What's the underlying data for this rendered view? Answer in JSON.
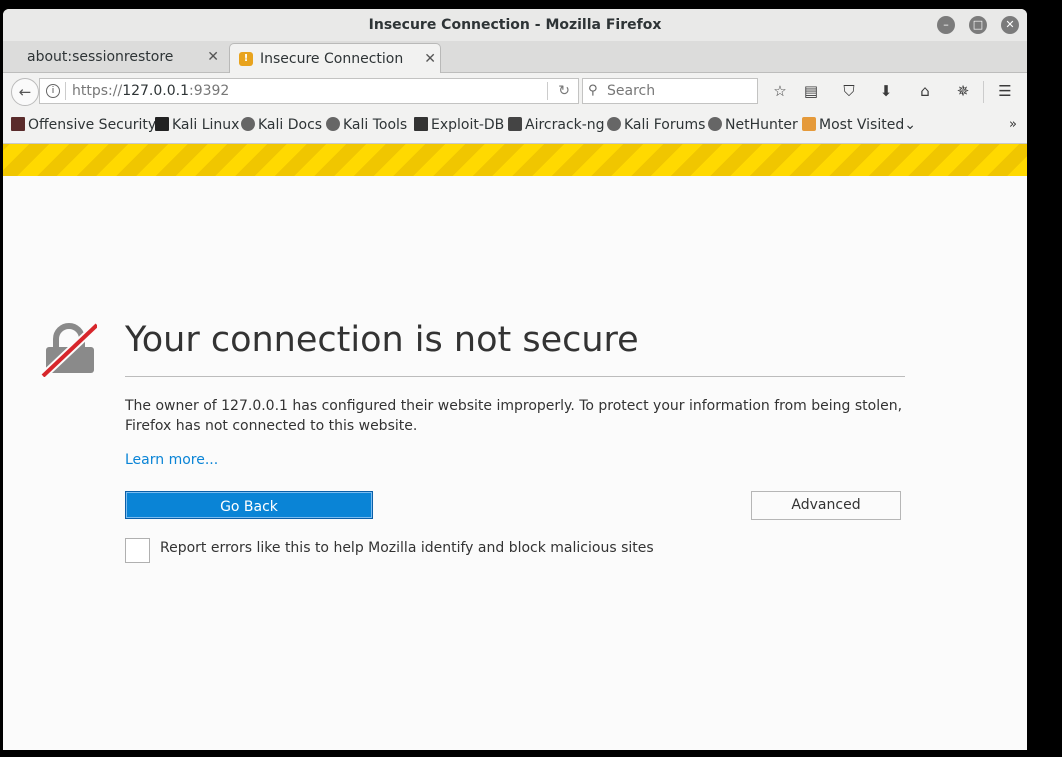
{
  "window": {
    "title": "Insecure Connection - Mozilla Firefox",
    "controls": [
      "minimize",
      "maximize",
      "close"
    ]
  },
  "tabs": [
    {
      "label": "about:sessionrestore",
      "active": false
    },
    {
      "label": "Insecure Connection",
      "active": true
    }
  ],
  "navbar": {
    "url_scheme": "https://",
    "url_host": "127.0.0.1",
    "url_port": ":9392",
    "search_placeholder": "Search"
  },
  "bookmarks": [
    {
      "label": "Offensive Security"
    },
    {
      "label": "Kali Linux"
    },
    {
      "label": "Kali Docs"
    },
    {
      "label": "Kali Tools"
    },
    {
      "label": "Exploit-DB"
    },
    {
      "label": "Aircrack-ng"
    },
    {
      "label": "Kali Forums"
    },
    {
      "label": "NetHunter"
    },
    {
      "label": "Most Visited"
    }
  ],
  "error_page": {
    "headline": "Your connection is not secure",
    "description": "The owner of 127.0.0.1 has configured their website improperly. To protect your information from being stolen, Firefox has not connected to this website.",
    "learn_more": "Learn more...",
    "go_back": "Go Back",
    "advanced": "Advanced",
    "report_label": "Report errors like this to help Mozilla identify and block malicious sites"
  },
  "colors": {
    "accent": "#0a84d6",
    "warning_stripe": "#ffd900",
    "strike": "#d7262b"
  }
}
